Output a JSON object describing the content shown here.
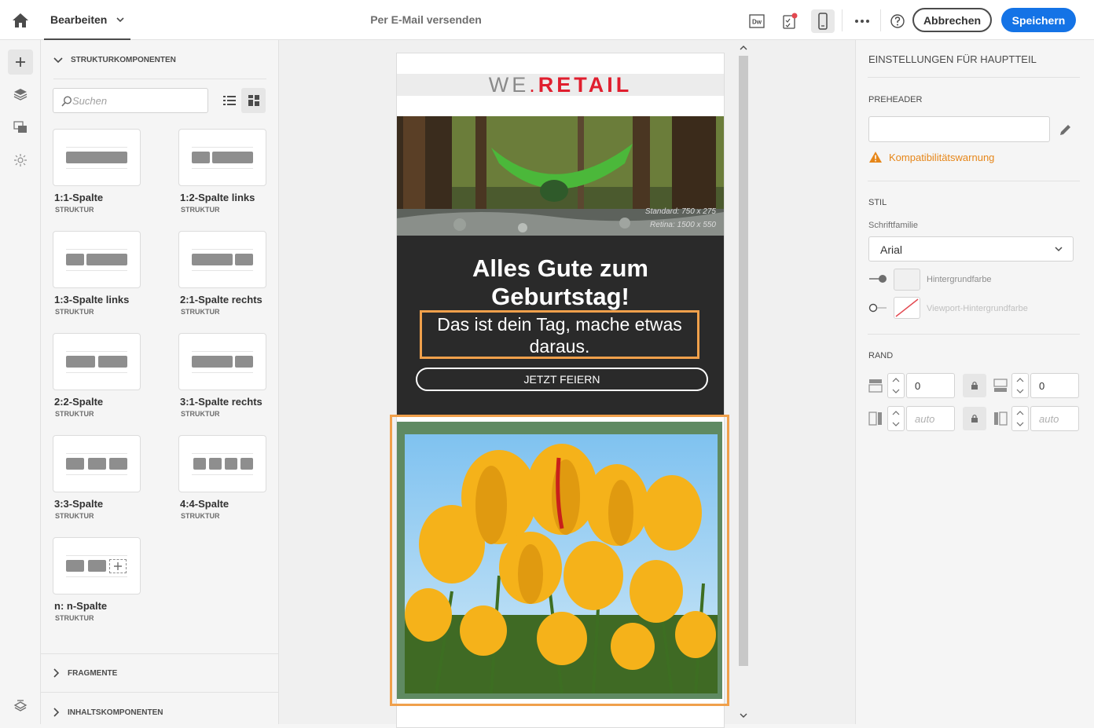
{
  "topbar": {
    "edit_label": "Bearbeiten",
    "title": "Per E-Mail versenden",
    "dw_label": "Dw",
    "cancel_label": "Abbrechen",
    "save_label": "Speichern"
  },
  "left_panel": {
    "structure_header": "STRUKTURKOMPONENTEN",
    "search_placeholder": "Suchen",
    "cards": [
      {
        "title": "1:1-Spalte",
        "sub": "STRUKTUR"
      },
      {
        "title": "1:2-Spalte links",
        "sub": "STRUKTUR"
      },
      {
        "title": "1:3-Spalte links",
        "sub": "STRUKTUR"
      },
      {
        "title": "2:1-Spalte rechts",
        "sub": "STRUKTUR"
      },
      {
        "title": "2:2-Spalte",
        "sub": "STRUKTUR"
      },
      {
        "title": "3:1-Spalte rechts",
        "sub": "STRUKTUR"
      },
      {
        "title": "3:3-Spalte",
        "sub": "STRUKTUR"
      },
      {
        "title": "4:4-Spalte",
        "sub": "STRUKTUR"
      },
      {
        "title": "n: n-Spalte",
        "sub": "STRUKTUR"
      }
    ],
    "fragments_header": "FRAGMENTE",
    "content_header": "INHALTSKOMPONENTEN"
  },
  "email": {
    "logo_we": "WE",
    "logo_dot": ".",
    "logo_retail": "RETAIL",
    "hero_note_1": "Standard: 750 x 275",
    "hero_note_2": "Retina: 1500 x 550",
    "headline": "Alles Gute zum Geburtstag!",
    "subline": "Das ist dein Tag, mache etwas daraus.",
    "cta": "JETZT FEIERN"
  },
  "right_panel": {
    "title": "EINSTELLUNGEN FÜR HAUPTTEIL",
    "preheader_label": "PREHEADER",
    "preheader_value": "",
    "warning": "Kompatibilitätswarnung",
    "style_label": "STIL",
    "font_family_label": "Schriftfamilie",
    "font_family_value": "Arial",
    "bg_color_label": "Hintergrundfarbe",
    "viewport_bg_label": "Viewport-Hintergrundfarbe",
    "margin_label": "RAND",
    "margin_top": "0",
    "margin_bottom": "0",
    "margin_left": "auto",
    "margin_right": "auto"
  },
  "colors": {
    "accent": "#1473e6",
    "selection": "#f0a04b",
    "warning": "#e68619",
    "brand_red": "#e01e2e"
  }
}
